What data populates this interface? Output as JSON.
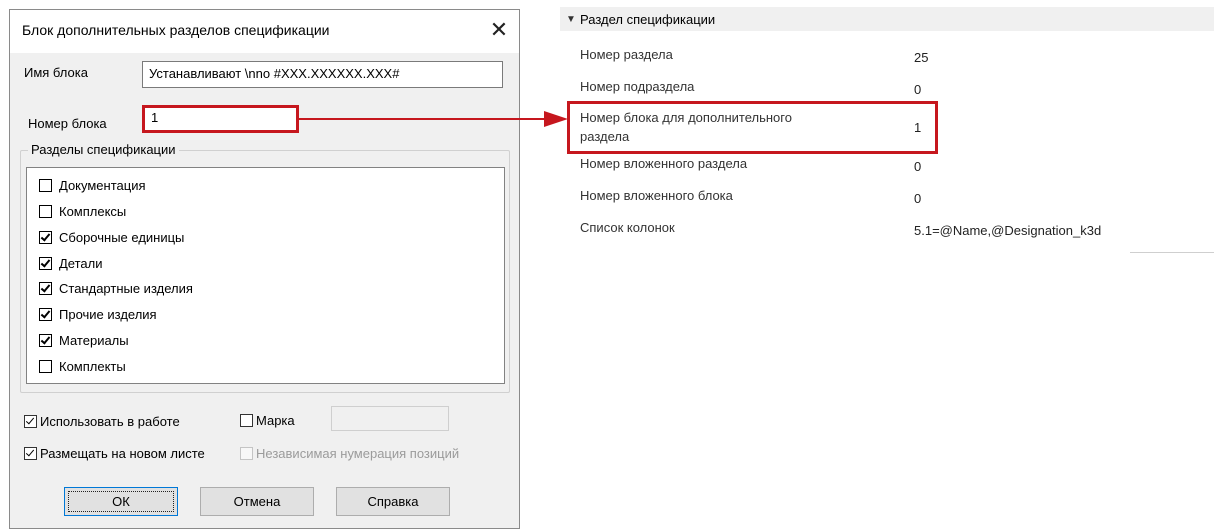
{
  "dialog": {
    "title": "Блок дополнительных разделов спецификации",
    "close_glyph": "✕",
    "block_name_label": "Имя блока",
    "block_name_value": "Устанавливают \\nnо #XXX.XXXXXX.XXX#",
    "block_number_label": "Номер блока",
    "block_number_value": "1",
    "group_label": "Разделы спецификации",
    "sections": [
      {
        "label": "Документация",
        "checked": false
      },
      {
        "label": "Комплексы",
        "checked": false
      },
      {
        "label": "Сборочные единицы",
        "checked": true
      },
      {
        "label": "Детали",
        "checked": true
      },
      {
        "label": "Стандартные изделия",
        "checked": true
      },
      {
        "label": "Прочие изделия",
        "checked": true
      },
      {
        "label": "Материалы",
        "checked": true
      },
      {
        "label": "Комплекты",
        "checked": false
      }
    ],
    "use_in_work": {
      "label": "Использовать в работе",
      "checked": true
    },
    "mark": {
      "label": "Марка",
      "checked": false,
      "value": ""
    },
    "place_new_sheet": {
      "label": "Размещать на новом листе",
      "checked": true
    },
    "independent_numbering": {
      "label": "Независимая нумерация позиций",
      "checked": false,
      "enabled": false
    },
    "buttons": {
      "ok": "ОК",
      "cancel": "Отмена",
      "help": "Справка"
    }
  },
  "properties": {
    "section_title": "Раздел спецификации",
    "chevron_icon": "chevron-down",
    "rows": [
      {
        "name": "Номер раздела",
        "value": "25"
      },
      {
        "name": "Номер подраздела",
        "value": "0"
      },
      {
        "name_lines": [
          "Номер блока для дополнительного",
          "раздела"
        ],
        "value": "1"
      },
      {
        "name": "Номер вложенного раздела",
        "value": "0"
      },
      {
        "name": "Номер вложенного блока",
        "value": "0"
      },
      {
        "name": "Список колонок",
        "value": "5.1=@Name,@Designation_k3d"
      }
    ]
  },
  "annotation": {
    "highlight_color": "#c6171e",
    "arrow_color": "#c6171e"
  }
}
